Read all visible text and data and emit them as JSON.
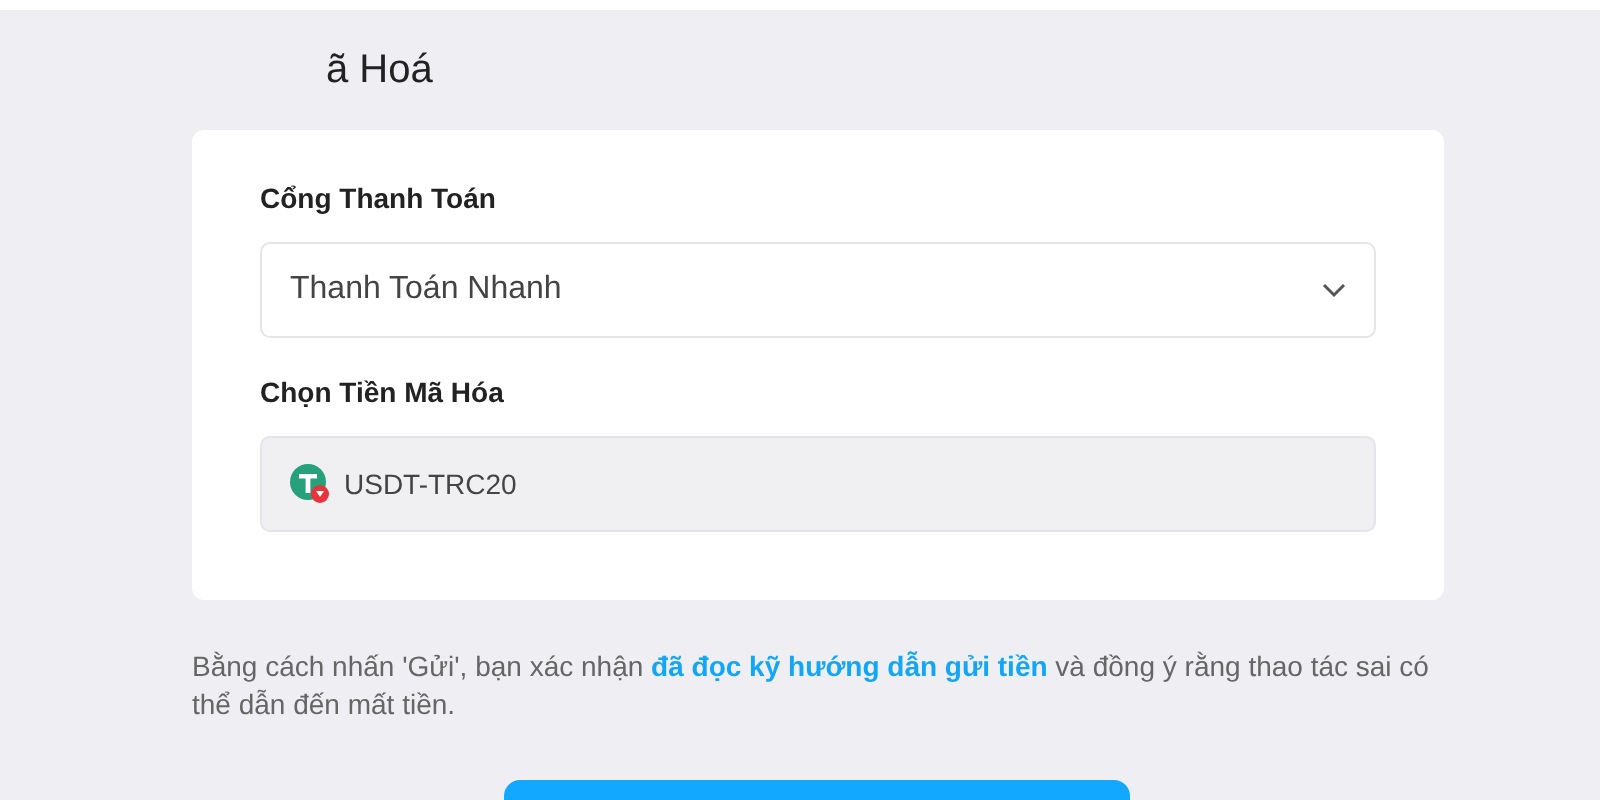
{
  "heading": "ã Hoá",
  "form": {
    "fields": [
      {
        "kind": "select",
        "label": "Cổng Thanh Toán",
        "value": "Thanh Toán Nhanh",
        "disabled": false
      },
      {
        "kind": "coin",
        "label": "Chọn Tiền Mã Hóa",
        "value": "USDT-TRC20",
        "disabled": true
      }
    ]
  },
  "notice": {
    "before": "Bằng cách nhấn 'Gửi', bạn xác nhận ",
    "link": "đã đọc kỹ hướng dẫn gửi tiền",
    "after": " và đồng ý rằng thao tác sai có thể dẫn đến mất tiền."
  }
}
